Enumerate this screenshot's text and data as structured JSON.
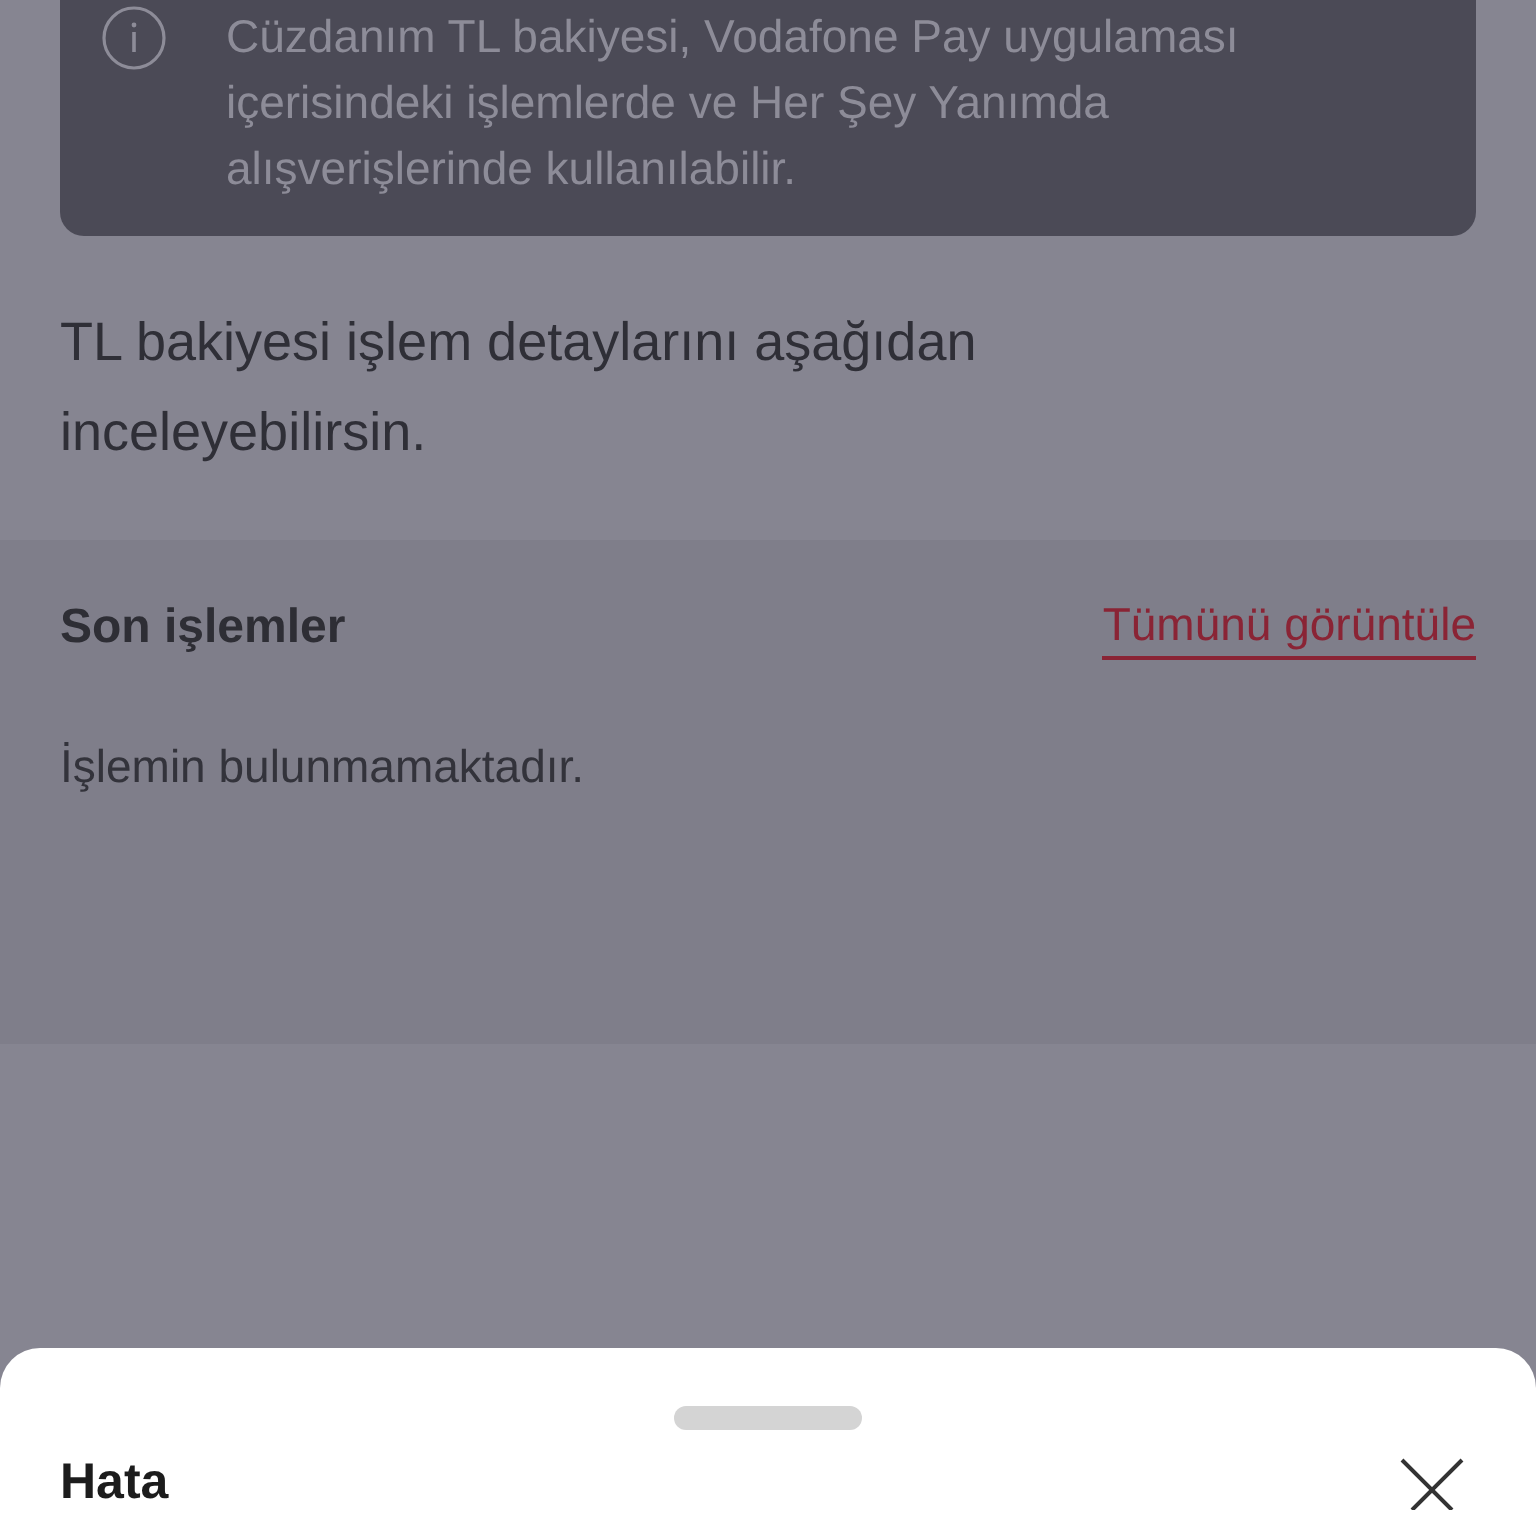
{
  "info_card": {
    "text": "Cüzdanım TL bakiyesi, Vodafone Pay uygulaması içerisindeki işlemlerde ve Her Şey Yanımda alışverişlerinde kullanılabilir."
  },
  "description": "TL bakiyesi işlem detaylarını aşağıdan inceleyebilirsin.",
  "recent_transactions": {
    "title": "Son işlemler",
    "link": "Tümünü görüntüle",
    "empty_message": "İşlemin bulunmamaktadır."
  },
  "bottom_sheet": {
    "title": "Hata"
  }
}
